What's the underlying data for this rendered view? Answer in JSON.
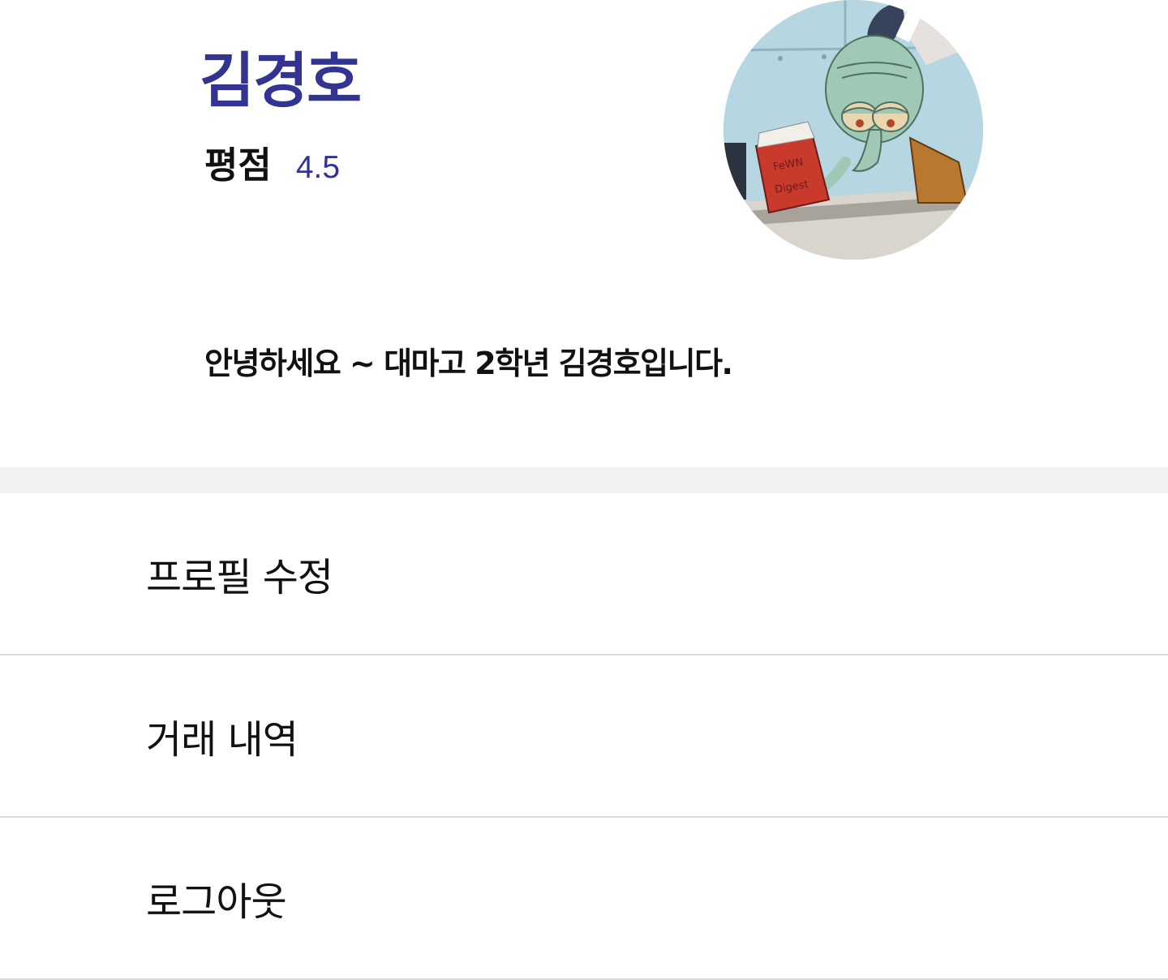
{
  "profile": {
    "name": "김경호",
    "rating_label": "평점",
    "rating_value": "4.5",
    "intro": "안녕하세요 ~ 대마고 2학년 김경호입니다.",
    "avatar_book_text_line1": "FeWN",
    "avatar_book_text_line2": "Digest"
  },
  "menu": {
    "items": [
      {
        "label": "프로필 수정"
      },
      {
        "label": "거래 내역"
      },
      {
        "label": "로그아웃"
      }
    ]
  },
  "colors": {
    "accent": "#333391",
    "text": "#111111",
    "divider_band": "#f2f2f2",
    "row_border": "#d9d9d9"
  }
}
